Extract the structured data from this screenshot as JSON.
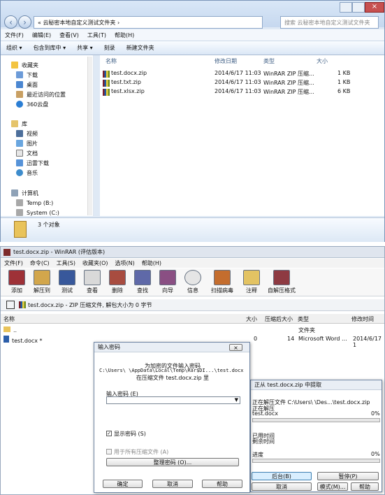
{
  "explorer": {
    "address": "« 云秘密本地自定义测试文件夹 ›",
    "search_placeholder": "搜索 云秘密本地自定义测试文件夹",
    "menu": [
      "文件(F)",
      "编辑(E)",
      "查看(V)",
      "工具(T)",
      "帮助(H)"
    ],
    "commands": [
      "组织 ▾",
      "包含到库中 ▾",
      "共享 ▾",
      "刻录",
      "新建文件夹"
    ],
    "nav": [
      "收藏夹",
      "下载",
      "桌面",
      "最近访问的位置",
      "360云盘",
      "库",
      "视频",
      "图片",
      "文档",
      "迅雷下载",
      "音乐",
      "计算机",
      "Temp (B:)",
      "System (C:)"
    ],
    "headers": [
      "名称",
      "修改日期",
      "类型",
      "大小"
    ],
    "files": [
      {
        "name": "test.docx.zip",
        "date": "2014/6/17 11:03",
        "type": "WinRAR ZIP 压缩...",
        "size": "1 KB"
      },
      {
        "name": "test.txt.zip",
        "date": "2014/6/17 11:03",
        "type": "WinRAR ZIP 压缩...",
        "size": "1 KB"
      },
      {
        "name": "test.xlsx.zip",
        "date": "2014/6/17 11:03",
        "type": "WinRAR ZIP 压缩...",
        "size": "6 KB"
      }
    ],
    "status": "3 个对象"
  },
  "winrar": {
    "title": "test.docx.zip - WinRAR (评估版本)",
    "menu": [
      "文件(F)",
      "命令(C)",
      "工具(S)",
      "收藏夹(O)",
      "选项(N)",
      "帮助(H)"
    ],
    "tools": [
      "添加",
      "解压到",
      "测试",
      "查看",
      "删除",
      "查找",
      "向导",
      "信息",
      "扫描病毒",
      "注释",
      "自解压格式"
    ],
    "path": "test.docx.zip - ZIP 压缩文件, 解包大小为 0 字节",
    "headers": [
      "名称",
      "大小",
      "压缩后大小",
      "类型",
      "修改时间"
    ],
    "rows": [
      {
        "name": "..",
        "size": "",
        "packed": "",
        "type": "文件夹",
        "modified": ""
      },
      {
        "name": "test.docx *",
        "size": "0",
        "packed": "14",
        "type": "Microsoft Word ...",
        "modified": "2014/6/17 1"
      }
    ]
  },
  "password_dialog": {
    "title": "输入密码",
    "line1": "为加密的文件输入密码",
    "line2": "C:\\Users\\        \\AppData\\Local\\Temp\\Rar$DI...\\test.docx",
    "line3": "在压缩文件 test.docx.zip 里",
    "label": "输入密码 (E)",
    "show_password": "显示密码 (S)",
    "use_all": "用于所有压缩文件 (A)",
    "manage": "整理密码 (O)...",
    "ok": "确定",
    "cancel": "取消",
    "help": "帮助"
  },
  "extract_dialog": {
    "title": "正从 test.docx.zip 中提取",
    "line1": "正在解压文件 C:\\Users\\    \\Des...\\test.docx.zip",
    "line2": "正在解压",
    "file": "test.docx",
    "file_percent": "0%",
    "elapsed": "已用时间",
    "remaining": "剩余时间",
    "progress": "进度",
    "progress_percent": "0%",
    "background": "后台(B)",
    "pause": "暂停(P)",
    "cancel": "取消",
    "mode": "模式(M)...",
    "help": "帮助"
  }
}
